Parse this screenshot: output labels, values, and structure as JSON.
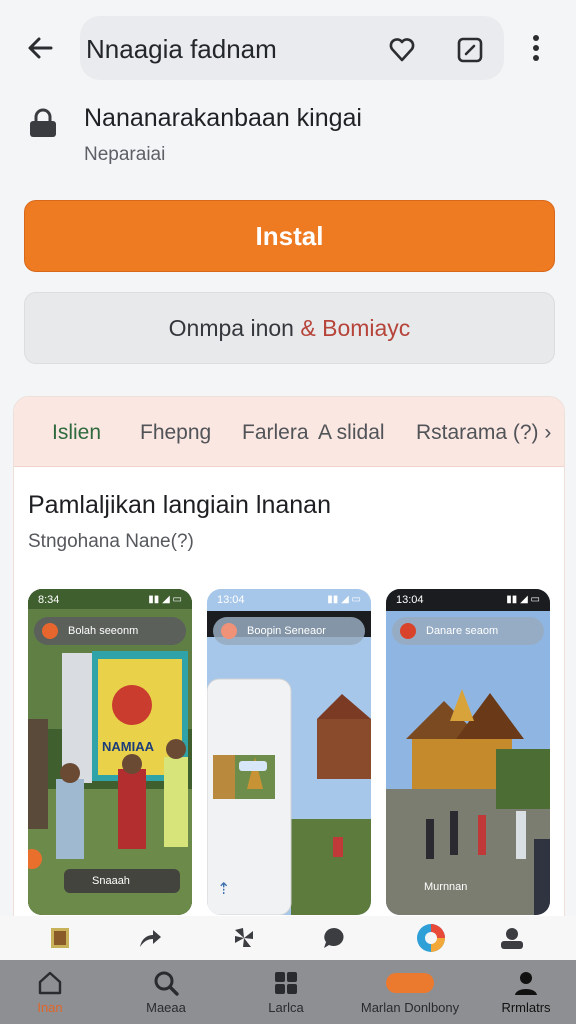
{
  "header": {
    "title": "Nnaagia fadnam"
  },
  "app": {
    "name": "Nananarakanbaan kingai",
    "subtitle": "Neparaiai"
  },
  "buttons": {
    "install_label": "Instal",
    "secondary_label_main": "Onmpa inon",
    "secondary_label_accent": "& Bomiayc"
  },
  "tabs": [
    {
      "label": "Islien"
    },
    {
      "label": "Fhepng"
    },
    {
      "label": "Farlera"
    },
    {
      "label": "A slidal"
    },
    {
      "label": "Rstarama (?) ›"
    }
  ],
  "section": {
    "title": "Pamlaljikan langiain lnanan",
    "subtitle": "Stngohana Nane(?)"
  },
  "screenshots": [
    {
      "time": "8:34",
      "search": "Bolah seeonm",
      "sign_text": "NAMIAA",
      "caption": "Snaaah"
    },
    {
      "time": "13:04",
      "search": "Boopin Seneaor",
      "caption": ""
    },
    {
      "time": "13:04",
      "search": "Danare seaom",
      "caption": "Murnnan"
    }
  ],
  "bottom_nav": [
    {
      "label": "Inan",
      "icon": "home-icon"
    },
    {
      "label": "Maeaa",
      "icon": "search-icon"
    },
    {
      "label": "Larlca",
      "icon": "apps-icon"
    },
    {
      "label": "Marlan Donlbony",
      "icon": "orange-pill-icon"
    },
    {
      "label": "Rrmlatrs",
      "icon": "person-icon"
    }
  ],
  "colors": {
    "accent": "#ee7a22",
    "tab_active": "#2d6a3e",
    "nav_bg": "#8e8f92"
  }
}
